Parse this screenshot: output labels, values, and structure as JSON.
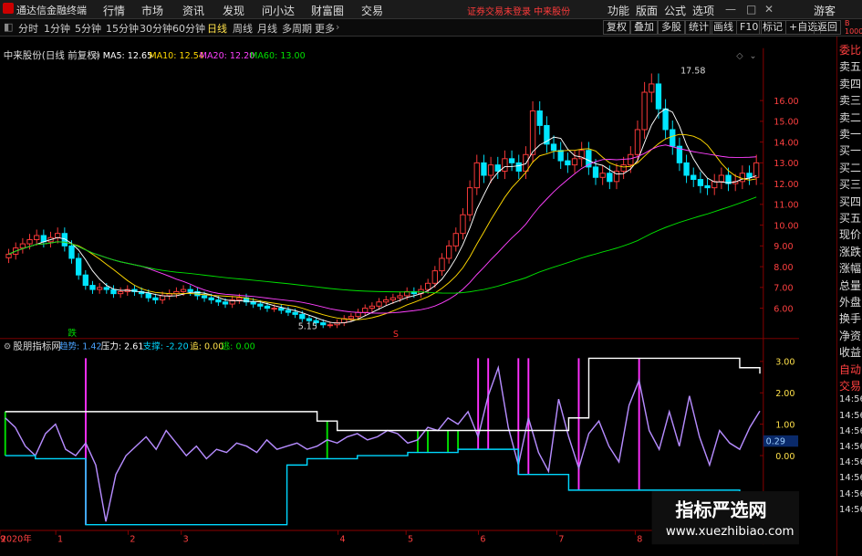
{
  "app": {
    "title": "通达信金融终端",
    "menu": [
      "行情",
      "市场",
      "资讯",
      "发现",
      "问小达",
      "财富圈",
      "交易"
    ],
    "notice": "证券交易未登录   中来股份",
    "menu_right": [
      "功能",
      "版面",
      "公式",
      "选项"
    ],
    "guest": "游客",
    "corner": "B 1000"
  },
  "toolbar": {
    "periods": [
      "分时",
      "1分钟",
      "5分钟",
      "15分钟",
      "30分钟",
      "60分钟",
      "日线",
      "周线",
      "月线",
      "多周期",
      "更多"
    ],
    "active_period": "日线",
    "right_buttons": [
      "复权",
      "叠加",
      "多股",
      "统计",
      "画线",
      "F10",
      "标记",
      "+自选",
      "返回"
    ]
  },
  "main_panel": {
    "header": "中来股份(日线 前复权)",
    "ma": [
      {
        "label": "MA5: 12.65",
        "color": "#ffffff"
      },
      {
        "label": "MA10: 12.54",
        "color": "#ffd800"
      },
      {
        "label": "MA20: 12.20",
        "color": "#ff40ff"
      },
      {
        "label": "MA60: 13.00",
        "color": "#00e000"
      }
    ],
    "high_label": "17.58",
    "low_label": "5.15",
    "fall_marker": "跌",
    "s_marker": "S"
  },
  "sub_panel": {
    "header": "股朋指标网",
    "fields": [
      {
        "label": "趋势: 1.42",
        "color": "#4aa3ff"
      },
      {
        "label": "压力: 2.61",
        "color": "#ffffff"
      },
      {
        "label": "支撑: -2.20",
        "color": "#00d8ff"
      },
      {
        "label": "追: 0.00",
        "color": "#ffe14a"
      },
      {
        "label": "逃: 0.00",
        "color": "#00e000"
      }
    ],
    "current_value": "0.29"
  },
  "right_panel": {
    "items": [
      "委比",
      "卖五",
      "卖四",
      "卖三",
      "卖二",
      "卖一",
      "买一",
      "买二",
      "买三",
      "买四",
      "买五",
      "现价",
      "涨跌",
      "涨幅",
      "总量",
      "外盘",
      "换手",
      "净资",
      "收益",
      "自动",
      "交易",
      "14:56",
      "14:56",
      "14:56",
      "14:56",
      "14:56",
      "14:56",
      "14:56",
      "14:56"
    ]
  },
  "watermark": {
    "title": "指标严选网",
    "url": "www.xuezhibiao.com"
  },
  "chart_data": [
    {
      "type": "candlestick",
      "title": "中来股份(日线 前复权)",
      "y_ticks": [
        "16.00",
        "15.00",
        "14.00",
        "13.00",
        "12.00",
        "11.00",
        "10.00",
        "9.00",
        "8.00",
        "7.00",
        "6.00"
      ],
      "ylim": [
        5.0,
        17.6
      ],
      "close": [
        8.6,
        8.9,
        9.1,
        9.3,
        9.5,
        9.2,
        9.4,
        9.6,
        9.0,
        8.4,
        7.6,
        7.1,
        6.9,
        7.0,
        6.9,
        6.7,
        6.8,
        6.9,
        6.8,
        6.7,
        6.5,
        6.4,
        6.6,
        6.7,
        6.8,
        6.9,
        6.8,
        6.6,
        6.5,
        6.4,
        6.3,
        6.2,
        6.4,
        6.5,
        6.3,
        6.2,
        6.1,
        6.0,
        6.0,
        5.9,
        5.8,
        5.7,
        5.5,
        5.4,
        5.3,
        5.2,
        5.2,
        5.3,
        5.5,
        5.6,
        5.8,
        6.0,
        6.1,
        6.3,
        6.4,
        6.5,
        6.6,
        6.8,
        6.7,
        6.9,
        7.2,
        7.8,
        8.4,
        9.0,
        9.6,
        10.5,
        11.8,
        13.0,
        12.4,
        12.9,
        12.6,
        13.2,
        13.0,
        12.6,
        13.4,
        15.5,
        14.8,
        13.9,
        13.6,
        13.1,
        12.9,
        13.2,
        13.6,
        12.8,
        12.3,
        12.5,
        12.1,
        12.6,
        12.9,
        13.4,
        14.6,
        16.4,
        16.8,
        15.6,
        14.6,
        13.8,
        13.0,
        12.4,
        12.2,
        11.9,
        11.8,
        12.1,
        12.4,
        12.0,
        12.1,
        12.5,
        12.3,
        13.0
      ],
      "ma_labels": [
        "MA5: 12.65",
        "MA10: 12.54",
        "MA20: 12.20",
        "MA60: 13.00"
      ],
      "annotations": [
        "17.58",
        "5.15"
      ]
    },
    {
      "type": "line",
      "title": "股朋指标网",
      "x_ticks": [
        "2020年",
        "1",
        "2",
        "3",
        "4",
        "5",
        "6",
        "7",
        "8",
        "9"
      ],
      "y_ticks": [
        "3.00",
        "2.00",
        "1.00",
        "0.29",
        "0.00"
      ],
      "ylim": [
        -2.3,
        3.2
      ],
      "series": [
        {
          "name": "趋势",
          "color": "#b68cff",
          "values": [
            1.2,
            0.9,
            0.3,
            0.0,
            0.7,
            1.0,
            0.2,
            0.0,
            0.4,
            -0.3,
            -2.1,
            -0.6,
            0.0,
            0.3,
            0.6,
            0.2,
            0.8,
            0.4,
            0.0,
            0.3,
            -0.1,
            0.2,
            0.1,
            0.4,
            0.3,
            0.1,
            0.5,
            0.2,
            0.3,
            0.4,
            0.2,
            0.3,
            0.5,
            0.4,
            0.6,
            0.7,
            0.5,
            0.6,
            0.8,
            0.7,
            0.4,
            0.5,
            0.9,
            0.8,
            1.2,
            1.0,
            1.4,
            0.6,
            1.9,
            2.8,
            0.9,
            -0.3,
            1.2,
            0.1,
            -0.5,
            1.8,
            0.6,
            -0.4,
            0.7,
            1.1,
            0.3,
            -0.2,
            1.6,
            2.4,
            0.8,
            0.2,
            1.4,
            0.3,
            1.9,
            0.6,
            -0.3,
            0.8,
            0.4,
            0.2,
            0.9,
            1.42
          ]
        },
        {
          "name": "压力",
          "color": "#ffffff",
          "values": [
            1.4,
            1.4,
            1.4,
            1.4,
            1.4,
            1.4,
            1.4,
            1.4,
            1.4,
            1.4,
            1.4,
            1.4,
            1.4,
            1.4,
            1.4,
            1.4,
            1.4,
            1.4,
            1.4,
            1.4,
            1.4,
            1.4,
            1.4,
            1.4,
            1.4,
            1.4,
            1.4,
            1.4,
            1.4,
            1.4,
            1.4,
            1.1,
            1.1,
            0.8,
            0.8,
            0.8,
            0.8,
            0.8,
            0.8,
            0.8,
            0.8,
            0.8,
            0.8,
            0.8,
            0.8,
            0.8,
            0.8,
            0.8,
            0.8,
            0.8,
            0.8,
            0.8,
            0.8,
            0.8,
            0.8,
            0.8,
            1.2,
            1.2,
            3.1,
            3.1,
            3.1,
            3.1,
            3.1,
            3.1,
            3.1,
            3.1,
            3.1,
            3.1,
            3.1,
            3.1,
            3.1,
            3.1,
            3.1,
            2.8,
            2.8,
            2.61
          ]
        },
        {
          "name": "支撑",
          "color": "#00d8ff",
          "values": [
            0.0,
            0.0,
            0.0,
            -0.1,
            -0.1,
            -0.1,
            -0.1,
            -0.1,
            -2.2,
            -2.2,
            -2.2,
            -2.2,
            -2.2,
            -2.2,
            -2.2,
            -2.2,
            -2.2,
            -2.2,
            -2.2,
            -2.2,
            -2.2,
            -2.2,
            -2.2,
            -2.2,
            -2.2,
            -2.2,
            -2.2,
            -2.2,
            -0.3,
            -0.3,
            -0.1,
            -0.1,
            -0.1,
            -0.1,
            -0.1,
            0.0,
            0.0,
            0.0,
            0.0,
            0.0,
            0.1,
            0.1,
            0.1,
            0.1,
            0.1,
            0.2,
            0.2,
            0.2,
            0.2,
            0.2,
            0.2,
            -0.6,
            -0.6,
            -0.6,
            -0.6,
            -0.6,
            -1.1,
            -1.1,
            -1.1,
            -1.1,
            -1.1,
            -1.1,
            -1.1,
            -1.1,
            -1.1,
            -1.1,
            -1.1,
            -1.1,
            -1.1,
            -1.1,
            -1.1,
            -1.1,
            -1.1,
            -2.2,
            -2.2,
            -2.2
          ]
        }
      ]
    }
  ]
}
